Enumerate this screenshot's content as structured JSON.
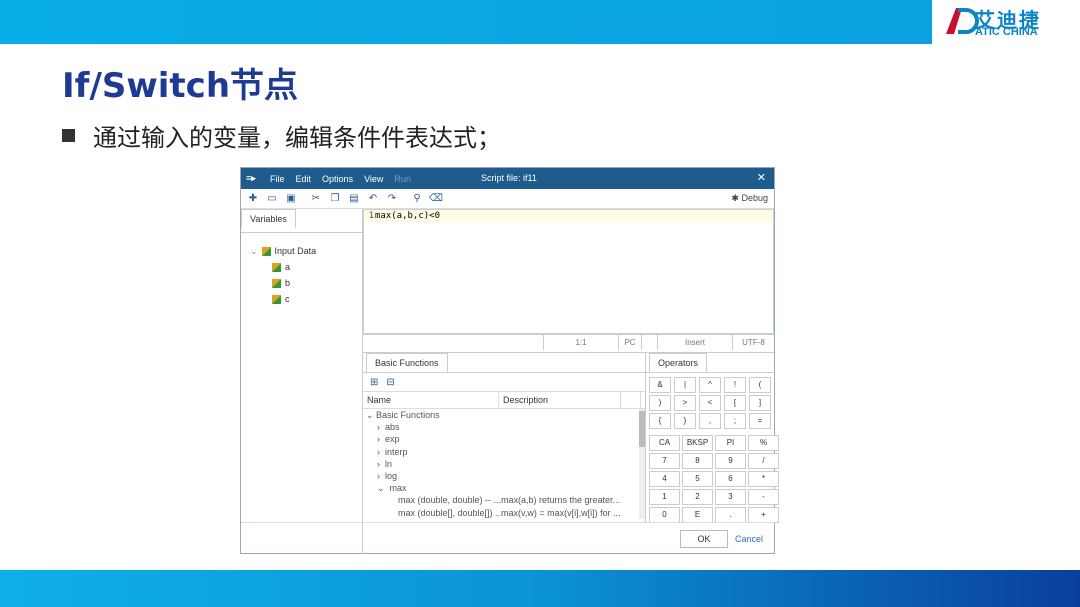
{
  "logo": {
    "cn": "艾迪捷",
    "en": "ATIC CHINA"
  },
  "slide": {
    "title": "If/Switch节点",
    "bullet": "通过输入的变量，编辑条件件表达式；"
  },
  "window": {
    "app_icon": "≡▸",
    "menus": [
      "File",
      "Edit",
      "Options",
      "View",
      "Run"
    ],
    "title": "Script file: if11",
    "close": "✕",
    "debug_label": "Debug"
  },
  "variables": {
    "tab": "Variables",
    "root": "Input Data",
    "items": [
      "a",
      "b",
      "c"
    ]
  },
  "editor": {
    "line_number": "1",
    "code": "max(a,b,c)<0"
  },
  "status": {
    "position": "1:1",
    "mode1": "PC",
    "insert": "Insert",
    "encoding": "UTF-8"
  },
  "functions": {
    "tab": "Basic Functions",
    "col_name": "Name",
    "col_desc": "Description",
    "group": "Basic Functions",
    "items": [
      "abs",
      "exp",
      "interp",
      "ln",
      "log",
      "max"
    ],
    "details": [
      {
        "name": "max (double, double) -- ...",
        "desc": "max(a,b) returns the greater..."
      },
      {
        "name": "max (double[], double[]) ...",
        "desc": "max(v,w) = max(v[i],w[i]) for ..."
      }
    ]
  },
  "operators": {
    "tab": "Operators",
    "row1": [
      "&",
      "|",
      "^",
      "!",
      "("
    ],
    "row2": [
      ")",
      ">",
      "<",
      "[",
      "]"
    ],
    "row3": [
      "{",
      "}",
      ",",
      ";",
      "="
    ],
    "keypad": [
      "CA",
      "BKSP",
      "PI",
      "%",
      "7",
      "8",
      "9",
      "/",
      "4",
      "5",
      "6",
      "*",
      "1",
      "2",
      "3",
      "-",
      "0",
      "E",
      ".",
      "+"
    ]
  },
  "footer": {
    "ok": "OK",
    "cancel": "Cancel"
  }
}
